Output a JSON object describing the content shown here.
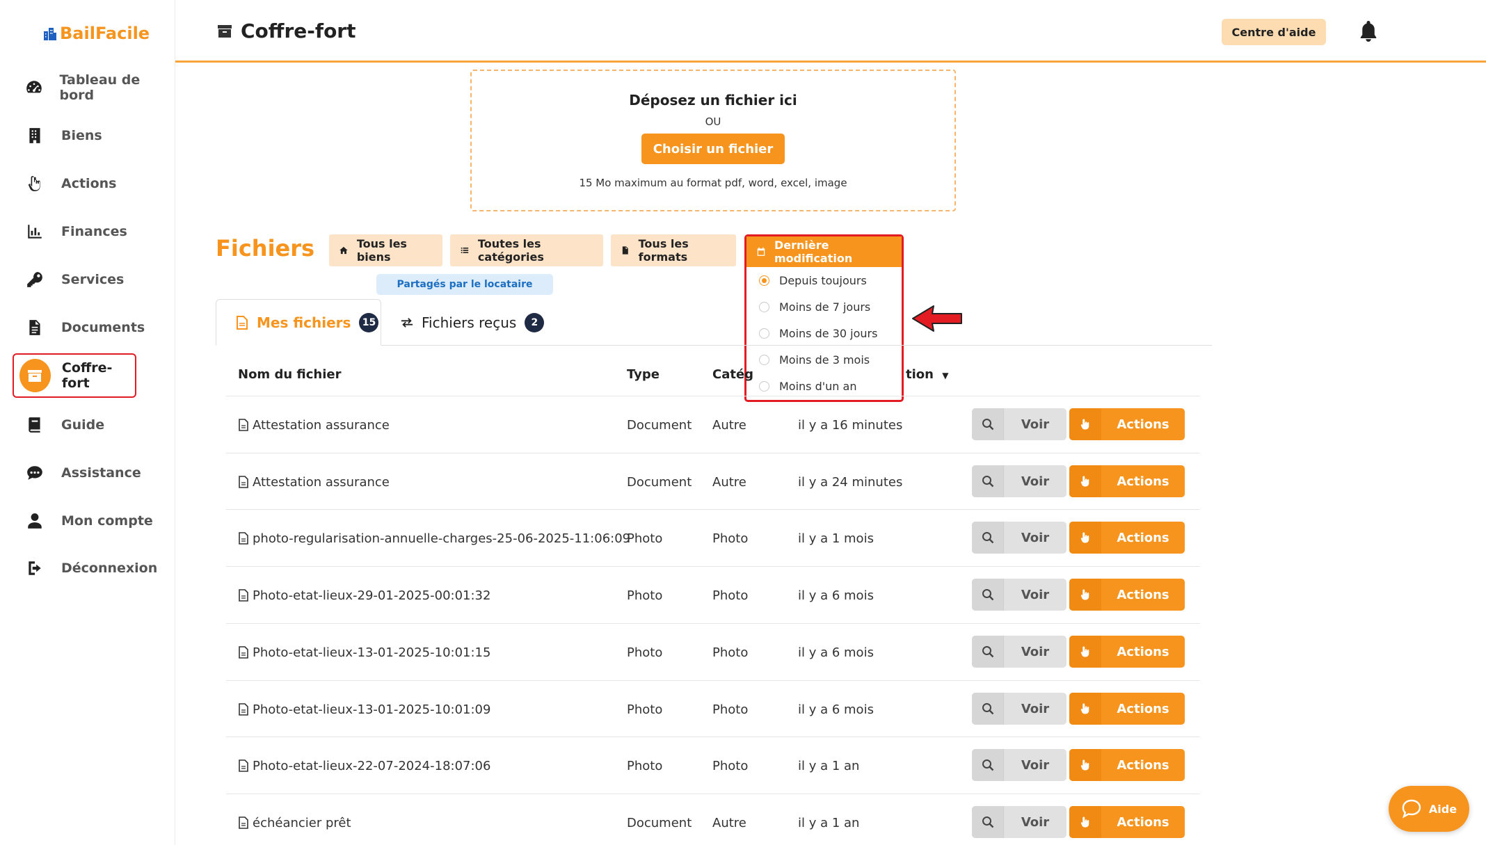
{
  "app": {
    "logo_text": "BailFacile"
  },
  "sidebar": {
    "items": [
      {
        "label": "Tableau de bord",
        "icon": "dashboard-icon"
      },
      {
        "label": "Biens",
        "icon": "building-icon"
      },
      {
        "label": "Actions",
        "icon": "hand-pointer-icon"
      },
      {
        "label": "Finances",
        "icon": "chart-icon"
      },
      {
        "label": "Services",
        "icon": "key-icon"
      },
      {
        "label": "Documents",
        "icon": "document-icon"
      },
      {
        "label": "Coffre-fort",
        "icon": "archive-icon",
        "active": true
      },
      {
        "label": "Guide",
        "icon": "book-icon"
      },
      {
        "label": "Assistance",
        "icon": "chat-icon"
      },
      {
        "label": "Mon compte",
        "icon": "user-icon"
      },
      {
        "label": "Déconnexion",
        "icon": "logout-icon"
      }
    ]
  },
  "header": {
    "title": "Coffre-fort",
    "help_label": "Centre d'aide"
  },
  "upload": {
    "title": "Déposez un fichier ici",
    "or": "OU",
    "button": "Choisir un fichier",
    "hint": "15 Mo maximum au format pdf, word, excel, image"
  },
  "files": {
    "title": "Fichiers",
    "filters": {
      "biens": "Tous les biens",
      "categories": "Toutes les catégories",
      "formats": "Tous les formats",
      "date": "Dernière modification"
    },
    "shared_badge": "Partagés par le locataire",
    "date_options": [
      "Depuis toujours",
      "Moins de 7 jours",
      "Moins de 30 jours",
      "Moins de 3 mois",
      "Moins d'un an"
    ],
    "selected_date_option": "Depuis toujours",
    "tabs": {
      "mine_label": "Mes fichiers",
      "mine_count": "15",
      "received_label": "Fichiers reçus",
      "received_count": "2"
    },
    "columns": {
      "name": "Nom du fichier",
      "type": "Type",
      "category": "Catég",
      "date": "tion"
    },
    "view_label": "Voir",
    "actions_label": "Actions",
    "rows": [
      {
        "name": "Attestation assurance",
        "type": "Document",
        "category": "Autre",
        "modified": "il y a 16 minutes"
      },
      {
        "name": "Attestation assurance",
        "type": "Document",
        "category": "Autre",
        "modified": "il y a 24 minutes"
      },
      {
        "name": "photo-regularisation-annuelle-charges-25-06-2025-11:06:09",
        "type": "Photo",
        "category": "Photo",
        "modified": "il y a 1 mois"
      },
      {
        "name": "Photo-etat-lieux-29-01-2025-00:01:32",
        "type": "Photo",
        "category": "Photo",
        "modified": "il y a 6 mois"
      },
      {
        "name": "Photo-etat-lieux-13-01-2025-10:01:15",
        "type": "Photo",
        "category": "Photo",
        "modified": "il y a 6 mois"
      },
      {
        "name": "Photo-etat-lieux-13-01-2025-10:01:09",
        "type": "Photo",
        "category": "Photo",
        "modified": "il y a 6 mois"
      },
      {
        "name": "Photo-etat-lieux-22-07-2024-18:07:06",
        "type": "Photo",
        "category": "Photo",
        "modified": "il y a 1 an"
      },
      {
        "name": "échéancier prêt",
        "type": "Document",
        "category": "Autre",
        "modified": "il y a 1 an"
      }
    ]
  },
  "help_widget": {
    "label": "Aide"
  },
  "colors": {
    "accent": "#f7941d",
    "highlight": "#e31b23",
    "badge": "#1f2a44"
  }
}
